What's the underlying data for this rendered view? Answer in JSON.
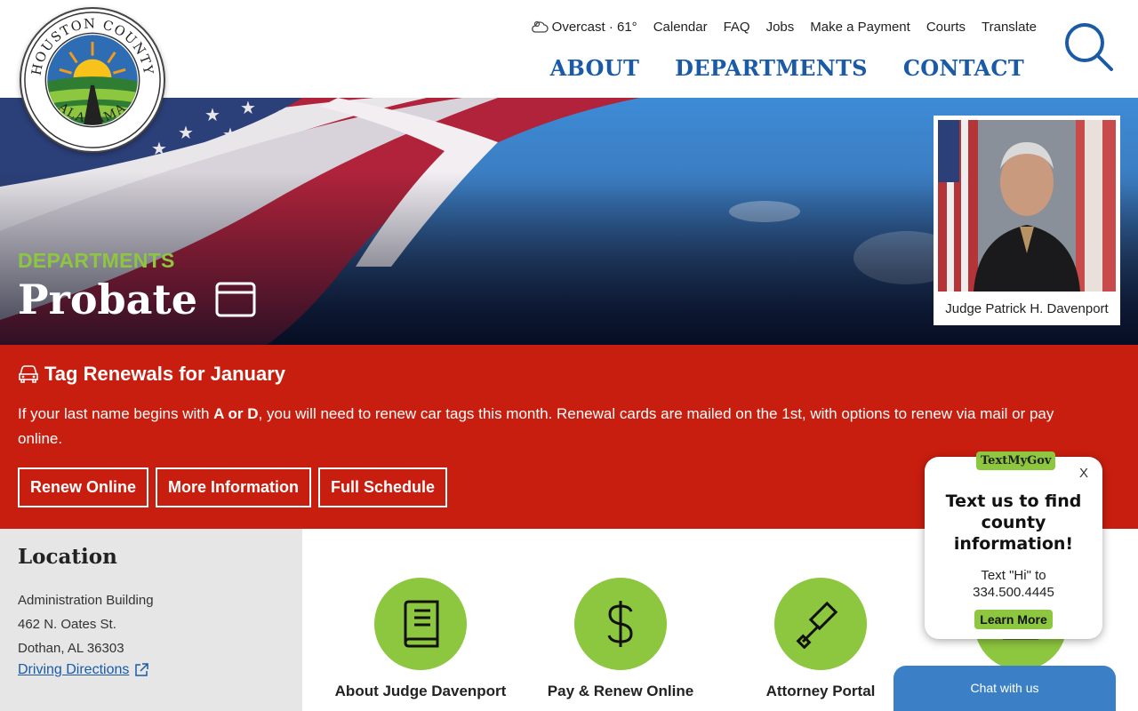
{
  "header": {
    "weather": "Overcast · 61°",
    "utility_links": [
      "Calendar",
      "FAQ",
      "Jobs",
      "Make a Payment",
      "Courts",
      "Translate"
    ],
    "main_nav": [
      "ABOUT",
      "DEPARTMENTS",
      "CONTACT"
    ],
    "logo_text_top": "HOUSTON COUNTY",
    "logo_text_bottom": "ALABAMA"
  },
  "hero": {
    "label": "DEPARTMENTS",
    "title": "Probate",
    "portrait_caption": "Judge Patrick H. Davenport"
  },
  "alert": {
    "title": "Tag Renewals for January",
    "body_pre": "If your last name begins with ",
    "body_bold": "A or D",
    "body_post": ", you will need to renew car tags this month. Renewal cards are mailed on the 1st, with options to renew via mail or pay online.",
    "buttons": [
      "Renew Online",
      "More Information",
      "Full Schedule"
    ]
  },
  "location": {
    "heading": "Location",
    "lines": [
      "Administration Building",
      "462 N. Oates St.",
      "Dothan, AL 36303"
    ],
    "directions": "Driving Directions"
  },
  "quick_links": [
    {
      "label": "About Judge Davenport",
      "icon": "book-icon"
    },
    {
      "label": "Pay & Renew Online",
      "icon": "dollar-icon"
    },
    {
      "label": "Attorney Portal",
      "icon": "gavel-icon"
    }
  ],
  "textmygov": {
    "badge": "TextMyGov",
    "close": "X",
    "heading": "Text us to find county information!",
    "text_line1": "Text \"Hi\" to",
    "text_line2": "334.500.4445",
    "button": "Learn More"
  },
  "chat": {
    "label": "Chat with us"
  },
  "colors": {
    "brand_blue": "#1a5aa6",
    "accent_green": "#8dc63f",
    "alert_red": "#c81e0f"
  }
}
